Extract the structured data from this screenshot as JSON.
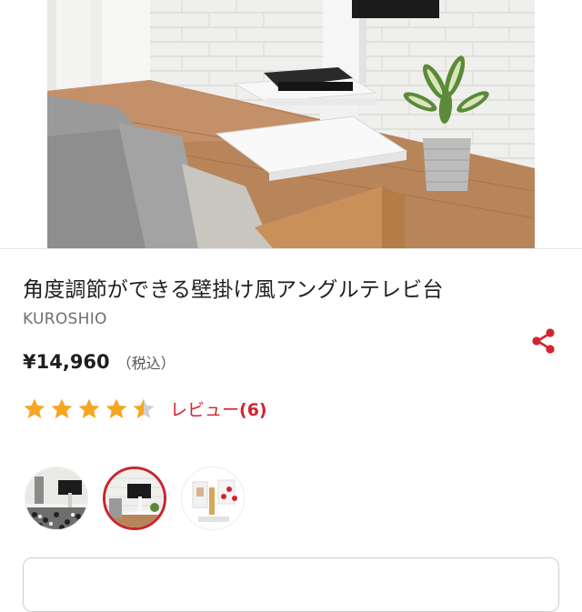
{
  "product": {
    "title": "角度調節ができる壁掛け風アングルテレビ台",
    "brand": "KUROSHIO",
    "price": "¥14,960",
    "tax_note": "（税込）",
    "rating": 4.5,
    "rating_max": 5,
    "review_label": "レビュー",
    "review_count": "(6)"
  },
  "thumbnails": [
    {
      "name": "thumbnail-1",
      "selected": false
    },
    {
      "name": "thumbnail-2",
      "selected": true
    },
    {
      "name": "thumbnail-3",
      "selected": false
    }
  ],
  "colors": {
    "accent": "#d3232f",
    "star": "#f5a623",
    "star_empty": "#cfcfcf"
  },
  "icons": {
    "share": "share-icon",
    "star": "star-icon"
  }
}
